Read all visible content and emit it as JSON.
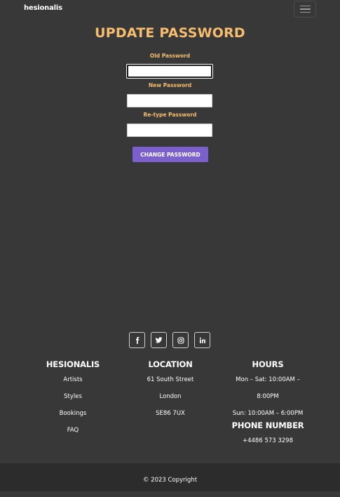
{
  "navbar": {
    "brand": "hesionalis",
    "menu_icon": "hamburger-icon"
  },
  "form": {
    "title": "UPDATE PASSWORD",
    "old_label": "Old Password",
    "new_label": "New Password",
    "retype_label": "Re-type Password",
    "old_value": "",
    "new_value": "",
    "retype_value": "",
    "submit_label": "CHANGE PASSWORD"
  },
  "social": [
    "facebook-icon",
    "twitter-icon",
    "instagram-icon",
    "linkedin-icon"
  ],
  "footer": {
    "brand_col": {
      "heading": "HESIONALIS",
      "links": [
        "Artists",
        "Styles",
        "Bookings",
        "FAQ"
      ]
    },
    "location_col": {
      "heading": "LOCATION",
      "lines": [
        "61 South Street",
        "London",
        "SE86 7UX"
      ]
    },
    "hours_col": {
      "heading": "HOURS",
      "weekday": "Mon – Sat: 10:00AM –",
      "weekday_end": "8:00PM",
      "sunday": "Sun: 10:00AM – 6:00PM",
      "phone_heading": "PHONE NUMBER",
      "phone": "+4486 573 3298"
    },
    "copyright": "© 2023 Copyright"
  },
  "colors": {
    "background": "#393838",
    "accent": "#f5bd6d",
    "button": "#7b5fcd",
    "footer_bar": "#2c2c2c"
  }
}
